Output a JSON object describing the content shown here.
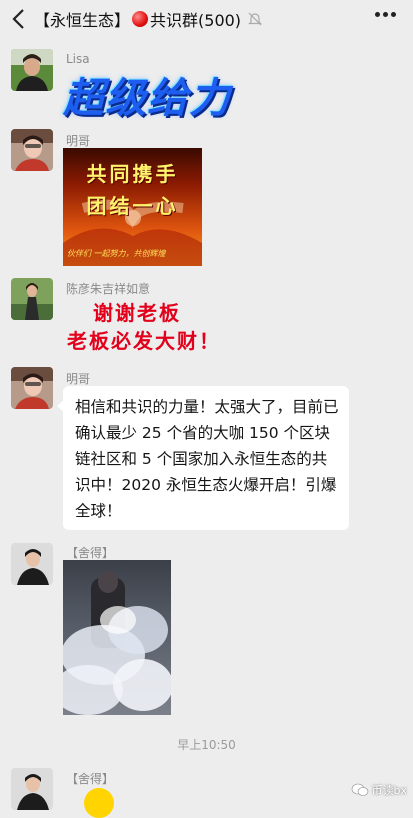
{
  "header": {
    "title_prefix": "【永恒生态】",
    "title_suffix": "共识群(500)"
  },
  "messages": [
    {
      "sender": "Lisa",
      "sticker_text": "超级给力"
    },
    {
      "sender": "明哥",
      "image_line1": "共同携手",
      "image_line2": "团结一心",
      "image_caption": "伙伴们 一起努力，共创辉煌"
    },
    {
      "sender": "陈彦朱吉祥如意",
      "sticker_line1": "谢谢老板",
      "sticker_line2": "老板必发大财！"
    },
    {
      "sender": "明哥",
      "text": "相信和共识的力量！太强大了，目前已确认最少 25 个省的大咖 150 个区块链社区和 5 个国家加入永恒生态的共识中！2020 永恒生态火爆开启！引爆全球！"
    },
    {
      "sender": "【舍得】"
    },
    {
      "sender": "【舍得】"
    }
  ],
  "timestamp": "早上10:50",
  "watermark": "币读bx"
}
